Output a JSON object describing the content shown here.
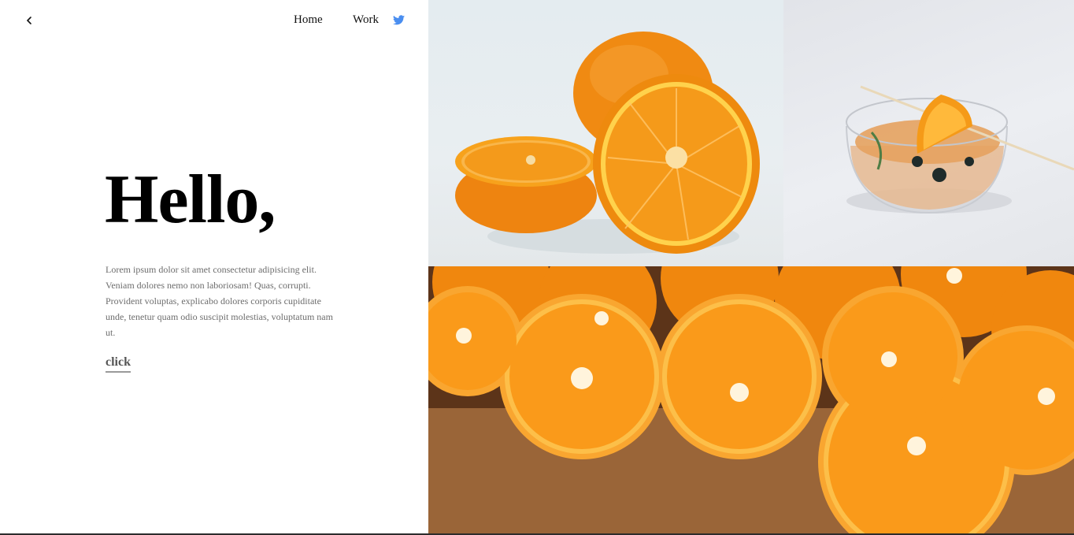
{
  "header": {
    "back_icon": "chevron-left-icon",
    "nav": {
      "home": "Home",
      "work": "Work",
      "social_icon": "twitter-icon"
    }
  },
  "hero": {
    "title": "Hello,",
    "body": "Lorem ipsum dolor sit amet consectetur adipisicing elit. Veniam dolores nemo non laboriosam! Quas, corrupti. Provident voluptas, explicabo dolores corporis cupiditate unde, tenetur quam odio suscipit molestias, voluptatum nam ut.",
    "cta": "click"
  },
  "gallery": {
    "images": [
      {
        "subject": "orange halves on white background"
      },
      {
        "subject": "orange juice cup with orange slice"
      },
      {
        "subject": "many halved oranges on wooden board"
      }
    ]
  },
  "colors": {
    "twitter": "#4a8ef0",
    "orange": "#f39a1f",
    "text_muted": "#6d6d6d"
  }
}
